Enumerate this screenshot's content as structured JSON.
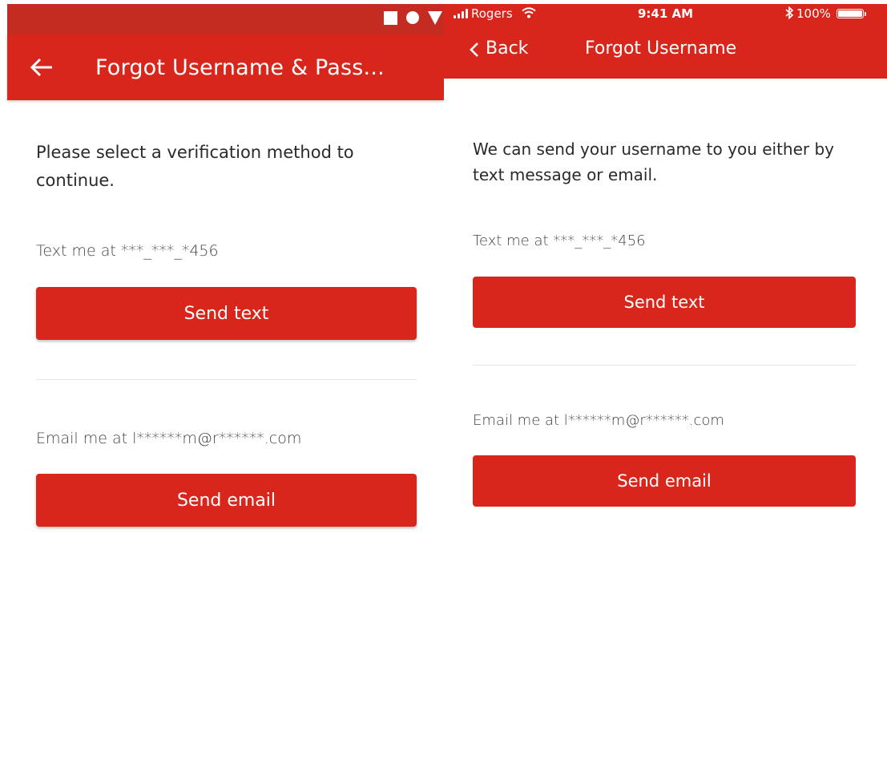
{
  "android": {
    "status_icons": [
      "square-icon",
      "circle-icon",
      "triangle-icon"
    ],
    "appbar": {
      "back_icon": "arrow-left-icon",
      "title": "Forgot Username & Pass..."
    },
    "intro": "Please select a verification method to continue.",
    "text_label": "Text me at ***_***_*456",
    "send_text_label": "Send text",
    "email_label": "Email me at l******m@r******.com",
    "send_email_label": "Send email"
  },
  "ios": {
    "status": {
      "carrier": "Rogers",
      "time": "9:41 AM",
      "battery_pct": "100%"
    },
    "nav": {
      "back_label": "Back",
      "title": "Forgot Username"
    },
    "intro": "We can send your username to you either by text message or email.",
    "text_label": "Text me at ***_***_*456",
    "send_text_label": "Send text",
    "email_label": "Email me at l******m@r******.com",
    "send_email_label": "Send email"
  },
  "colors": {
    "brand_red": "#d9261c",
    "status_red": "#c42b21",
    "text_dark": "#2a2a2a",
    "text_muted": "#444444",
    "divider": "#e6e6e6"
  }
}
